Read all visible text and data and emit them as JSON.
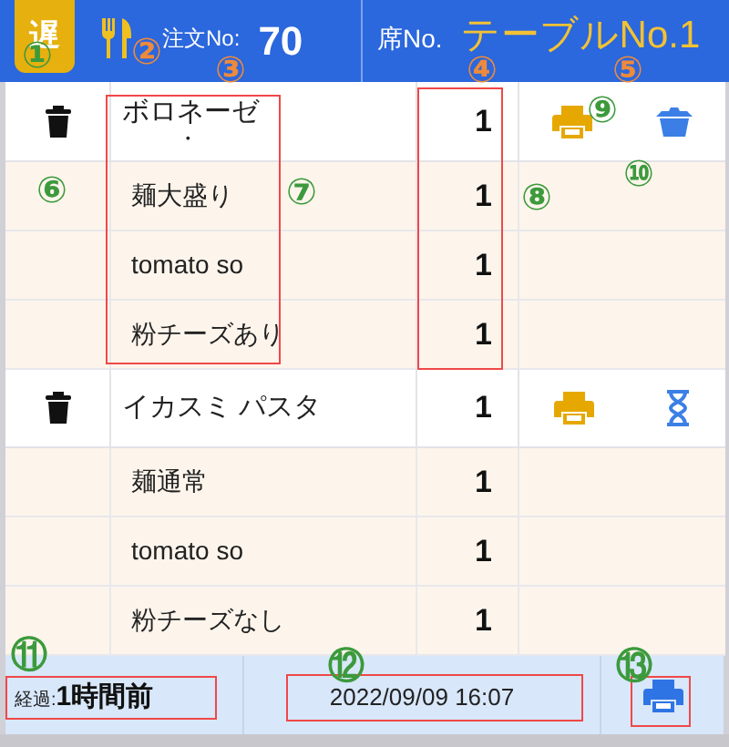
{
  "header": {
    "badge": "遅",
    "order_label": "注文No:",
    "order_no": "70",
    "seat_label": "席No.",
    "seat": "テーブルNo.1"
  },
  "orders": [
    {
      "name_lines": [
        "ボロネーゼ",
        "・"
      ],
      "qty": "1",
      "kind": "basket",
      "options": [
        {
          "name": "麺大盛り",
          "qty": "1"
        },
        {
          "name": "tomato so",
          "qty": "1"
        },
        {
          "name": "粉チーズあり",
          "qty": "1"
        }
      ]
    },
    {
      "name_lines": [
        "イカスミ パスタ"
      ],
      "qty": "1",
      "kind": "hourglass",
      "options": [
        {
          "name": "麺通常",
          "qty": "1"
        },
        {
          "name": "tomato so",
          "qty": "1"
        },
        {
          "name": "粉チーズなし",
          "qty": "1"
        }
      ]
    }
  ],
  "footer": {
    "elapsed_label": "経過:",
    "elapsed": "1時間前",
    "datetime": "2022/09/09 16:07"
  },
  "callouts": [
    {
      "text": "①",
      "color": "#3c9a3c"
    },
    {
      "text": "②",
      "color": "#ee8a3c"
    },
    {
      "text": "③",
      "color": "#ee8a3c"
    },
    {
      "text": "④",
      "color": "#ee8a3c"
    },
    {
      "text": "⑤",
      "color": "#ee8a3c"
    },
    {
      "text": "⑥",
      "color": "#3c9a3c"
    },
    {
      "text": "⑦",
      "color": "#3c9a3c"
    },
    {
      "text": "⑧",
      "color": "#3c9a3c"
    },
    {
      "text": "⑨",
      "color": "#3c9a3c"
    },
    {
      "text": "⑩",
      "color": "#3c9a3c"
    },
    {
      "text": "⑪",
      "color": "#3c9a3c"
    },
    {
      "text": "⑫",
      "color": "#3c9a3c"
    },
    {
      "text": "⑬",
      "color": "#3c9a3c"
    }
  ]
}
